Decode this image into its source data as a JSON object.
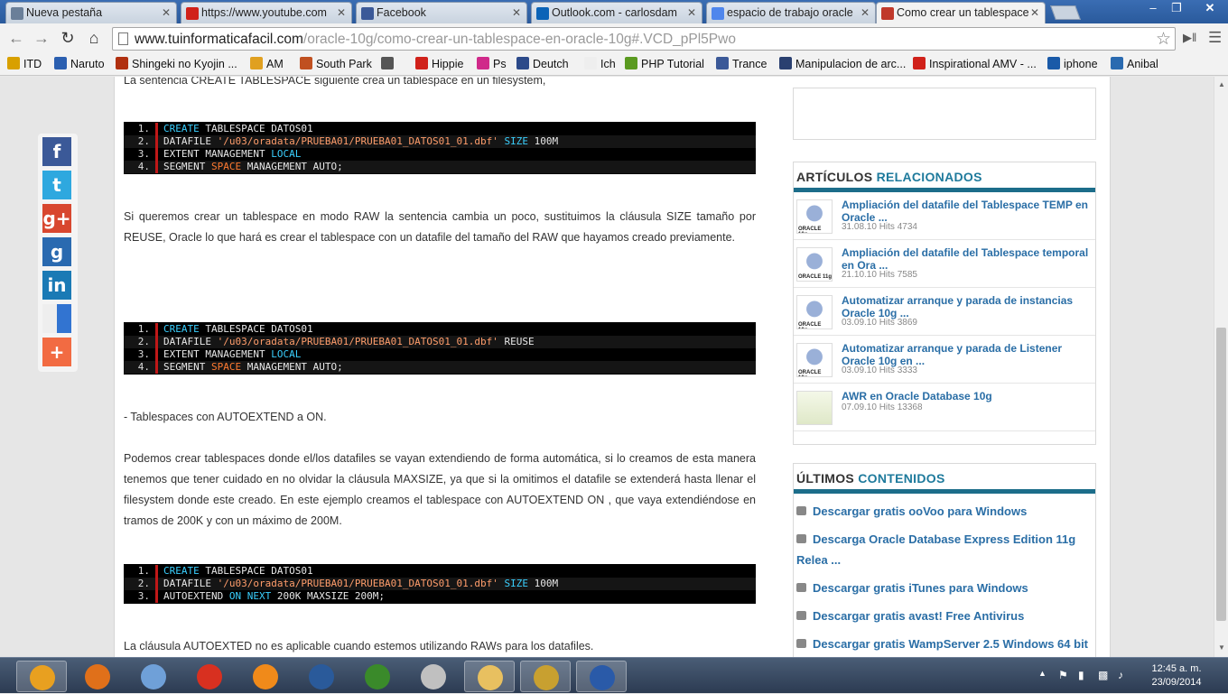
{
  "browser": {
    "tabs": [
      {
        "label": "Nueva pestaña",
        "favcolor": "#6a7f99",
        "active": false
      },
      {
        "label": "https://www.youtube.com",
        "favcolor": "#d0211a",
        "active": false
      },
      {
        "label": "Facebook",
        "favcolor": "#3b5998",
        "active": false
      },
      {
        "label": "Outlook.com - carlosdam",
        "favcolor": "#0b63b7",
        "active": false
      },
      {
        "label": "espacio de trabajo oracle",
        "favcolor": "#4f86ec",
        "active": false
      },
      {
        "label": "Como crear un tablespace",
        "favcolor": "#c0392b",
        "active": true
      }
    ],
    "url_host": "www.tuinformaticafacil.com",
    "url_path": "/oracle-10g/como-crear-un-tablespace-en-oracle-10g#.VCD_pPl5Pwo",
    "bookmarks": [
      {
        "label": "ITD",
        "color": "#d8a000"
      },
      {
        "label": "Naruto",
        "color": "#2b5fb0"
      },
      {
        "label": "Shingeki no Kyojin ...",
        "color": "#b03010"
      },
      {
        "label": "AM",
        "color": "#e0a020"
      },
      {
        "label": "South Park",
        "color": "#c05020"
      },
      {
        "label": "",
        "color": "#555555"
      },
      {
        "label": "Hippie",
        "color": "#d0211a"
      },
      {
        "label": "Ps",
        "color": "#d02a8a"
      },
      {
        "label": "Deutch",
        "color": "#2c4a8a"
      },
      {
        "label": "Ich",
        "color": "#eeeeee"
      },
      {
        "label": "PHP Tutorial",
        "color": "#5a9a20"
      },
      {
        "label": "Trance",
        "color": "#3b5998"
      },
      {
        "label": "Manipulacion de arc...",
        "color": "#2a4070"
      },
      {
        "label": "Inspirational AMV - ...",
        "color": "#d0211a"
      },
      {
        "label": "iphone",
        "color": "#1a5aa8"
      },
      {
        "label": "Anibal",
        "color": "#2a6ab0"
      }
    ]
  },
  "article": {
    "top_text": "La sentencia CREATE TABLESPACE siguiente crea un tablespace en un filesystem,",
    "para_raw": "Si queremos crear un tablespace en modo RAW la sentencia cambia un poco, sustituimos la cláusula SIZE tamaño por REUSE, Oracle lo que hará es crear el tablespace con un datafile del tamaño del RAW que hayamos creado previamente.",
    "para_autoextend_title": "- Tablespaces con AUTOEXTEND a ON.",
    "para_autoextend": "Podemos crear tablespaces donde el/los datafiles se vayan extendiendo de forma automática, si lo creamos de esta manera tenemos que tener cuidado en no olvidar la cláusula MAXSIZE, ya que si la omitimos el datafile se extenderá hasta llenar el filesystem donde este creado. En este ejemplo creamos el tablespace con AUTOEXTEND ON , que vaya extendiéndose en tramos de 200K y con un máximo de 200M.",
    "para_bottom": "La cláusula AUTOEXTED no es aplicable cuando estemos utilizando RAWs para los datafiles.",
    "code1": [
      {
        "n": "1.",
        "parts": [
          [
            "k1",
            "CREATE"
          ],
          [
            "t",
            " TABLESPACE DATOS01"
          ]
        ]
      },
      {
        "n": "2.",
        "parts": [
          [
            "t",
            "DATAFILE "
          ],
          [
            "str",
            "'/u03/oradata/PRUEBA01/PRUEBA01_DATOS01_01.dbf'"
          ],
          [
            "t",
            " "
          ],
          [
            "k1",
            "SIZE"
          ],
          [
            "t",
            " 100M"
          ]
        ]
      },
      {
        "n": "3.",
        "parts": [
          [
            "t",
            "EXTENT MANAGEMENT "
          ],
          [
            "k1",
            "LOCAL"
          ]
        ]
      },
      {
        "n": "4.",
        "parts": [
          [
            "t",
            "SEGMENT "
          ],
          [
            "k2",
            "SPACE"
          ],
          [
            "t",
            " MANAGEMENT AUTO;"
          ]
        ]
      }
    ],
    "code2": [
      {
        "n": "1.",
        "parts": [
          [
            "k1",
            "CREATE"
          ],
          [
            "t",
            " TABLESPACE DATOS01"
          ]
        ]
      },
      {
        "n": "2.",
        "parts": [
          [
            "t",
            "DATAFILE "
          ],
          [
            "str",
            "'/u03/oradata/PRUEBA01/PRUEBA01_DATOS01_01.dbf'"
          ],
          [
            "t",
            " REUSE"
          ]
        ]
      },
      {
        "n": "3.",
        "parts": [
          [
            "t",
            "EXTENT MANAGEMENT "
          ],
          [
            "k1",
            "LOCAL"
          ]
        ]
      },
      {
        "n": "4.",
        "parts": [
          [
            "t",
            "SEGMENT "
          ],
          [
            "k2",
            "SPACE"
          ],
          [
            "t",
            " MANAGEMENT AUTO;"
          ]
        ]
      }
    ],
    "code3": [
      {
        "n": "1.",
        "parts": [
          [
            "k1",
            "CREATE"
          ],
          [
            "t",
            " TABLESPACE DATOS01"
          ]
        ]
      },
      {
        "n": "2.",
        "parts": [
          [
            "t",
            "DATAFILE "
          ],
          [
            "str",
            "'/u03/oradata/PRUEBA01/PRUEBA01_DATOS01_01.dbf'"
          ],
          [
            "t",
            " "
          ],
          [
            "k1",
            "SIZE"
          ],
          [
            "t",
            " 100M"
          ]
        ]
      },
      {
        "n": "3.",
        "parts": [
          [
            "t",
            "AUTOEXTEND "
          ],
          [
            "k1",
            "ON NEXT"
          ],
          [
            "t",
            " 200K MAXSIZE 200M;"
          ]
        ]
      }
    ]
  },
  "share": [
    {
      "name": "facebook-share-icon",
      "glyph": "f",
      "color": "#3b5998"
    },
    {
      "name": "twitter-share-icon",
      "glyph": "t",
      "color": "#2ea8df"
    },
    {
      "name": "googleplus-share-icon",
      "glyph": "g+",
      "color": "#d8472f"
    },
    {
      "name": "google-share-icon",
      "glyph": "g",
      "color": "#2a6ab0"
    },
    {
      "name": "linkedin-share-icon",
      "glyph": "in",
      "color": "#1a7ab5"
    },
    {
      "name": "delicious-share-icon",
      "glyph": "",
      "color": "#3274d1"
    },
    {
      "name": "more-share-icon",
      "glyph": "+",
      "color": "#f26b42"
    }
  ],
  "sidebar": {
    "related_title_a": "ARTÍCULOS",
    "related_title_b": "RELACIONADOS",
    "related": [
      {
        "title": "Ampliación del datafile del Tablespace TEMP en Oracle ...",
        "meta": "31.08.10 Hits 4734",
        "thumb": "ORACLE 10g"
      },
      {
        "title": "Ampliación del datafile del Tablespace temporal en Ora ...",
        "meta": "21.10.10 Hits 7585",
        "thumb": "ORACLE 11g"
      },
      {
        "title": "Automatizar arranque y parada de instancias Oracle 10g ...",
        "meta": "03.09.10 Hits 3869",
        "thumb": "ORACLE 10g"
      },
      {
        "title": "Automatizar arranque y parada de Listener Oracle 10g en ...",
        "meta": "03.09.10 Hits 3333",
        "thumb": "ORACLE 10g"
      },
      {
        "title": "AWR en Oracle Database 10g",
        "meta": "07.09.10 Hits 13368",
        "thumb": ""
      }
    ],
    "latest_title_a": "ÚLTIMOS",
    "latest_title_b": "CONTENIDOS",
    "latest": [
      "Descargar gratis ooVoo para Windows",
      "Descarga Oracle Database Express Edition 11g Relea ...",
      "Descargar gratis iTunes para Windows",
      "Descargar gratis avast! Free Antivirus",
      "Descargar gratis WampServer 2.5 Windows 64 bit"
    ]
  },
  "taskbar": {
    "apps": [
      {
        "name": "chrome-taskbar-icon",
        "color": "#e8a020",
        "active": true
      },
      {
        "name": "firefox-taskbar-icon",
        "color": "#e0701a",
        "active": false
      },
      {
        "name": "virtualbox-taskbar-icon",
        "color": "#6fa0d8",
        "active": false
      },
      {
        "name": "ccleaner-taskbar-icon",
        "color": "#d83020",
        "active": false
      },
      {
        "name": "settings-taskbar-icon",
        "color": "#f08a1a",
        "active": false
      },
      {
        "name": "app-taskbar-icon",
        "color": "#2a5a9a",
        "active": false
      },
      {
        "name": "map-taskbar-icon",
        "color": "#3a8a2a",
        "active": false
      },
      {
        "name": "presentation-taskbar-icon",
        "color": "#c0c0c0",
        "active": false
      },
      {
        "name": "explorer-taskbar-icon",
        "color": "#e8c060",
        "active": true
      },
      {
        "name": "league-taskbar-icon",
        "color": "#c8a030",
        "active": true
      },
      {
        "name": "word-taskbar-icon",
        "color": "#2a5aa8",
        "active": true
      }
    ],
    "time": "12:45 a. m.",
    "date": "23/09/2014"
  }
}
